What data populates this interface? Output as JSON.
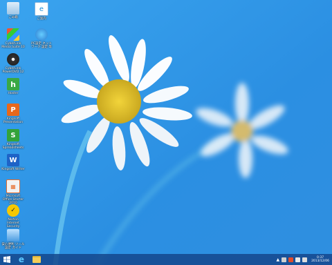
{
  "desktop": {
    "icons": [
      {
        "name": "recycle-bin-icon",
        "label": "ごみ箱"
      },
      {
        "name": "internet-shortcut-icon",
        "label": "ご案内"
      },
      {
        "name": "media-player-icon",
        "label": "CyberLink Media Suite 10"
      },
      {
        "name": "network-setup-icon",
        "label": "PC設定 ネットワーク 設定 等"
      },
      {
        "name": "cyberlink-dvd-icon",
        "label": "CyberLink PowerDVD 12"
      },
      {
        "name": "hoster-icon",
        "label": "Hoster"
      },
      {
        "name": "kingsoft-presentation-icon",
        "label": "Kingsoft Presentation"
      },
      {
        "name": "kingsoft-spreadsheets-icon",
        "label": "Kingsoft Spreadsheets"
      },
      {
        "name": "kingsoft-writer-icon",
        "label": "Kingsoft Writer"
      },
      {
        "name": "office-viewer-icon",
        "label": "Microsoft Office Starter 2010"
      },
      {
        "name": "norton-security-icon",
        "label": "Norton Internet Security"
      },
      {
        "name": "pc-settings-icon",
        "label": "安心便利 ツール 設定 ガイド"
      }
    ]
  },
  "taskbar": {
    "start": "start-icon",
    "ie": "internet-explorer-icon",
    "explorer": "file-explorer-icon",
    "clock_time": "0:37",
    "clock_date": "2013/12/06"
  }
}
